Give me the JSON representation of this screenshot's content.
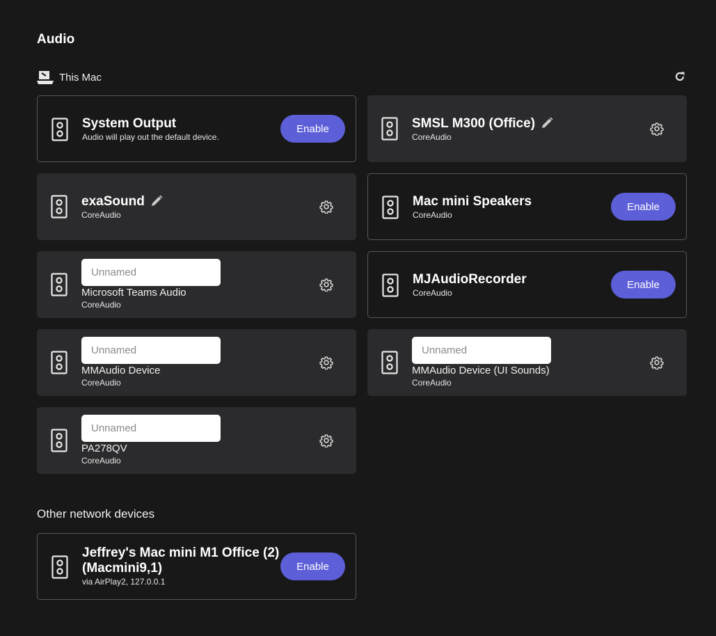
{
  "page": {
    "title": "Audio"
  },
  "this_mac": {
    "label": "This Mac"
  },
  "devices": {
    "system_output": {
      "name": "System Output",
      "subtitle": "Audio will play out the default device.",
      "button": "Enable"
    },
    "smsl": {
      "name": "SMSL M300 (Office)",
      "subtitle": "CoreAudio"
    },
    "exasound": {
      "name": "exaSound",
      "subtitle": "CoreAudio"
    },
    "mac_mini_speakers": {
      "name": "Mac mini Speakers",
      "subtitle": "CoreAudio",
      "button": "Enable"
    },
    "teams": {
      "placeholder": "Unnamed",
      "name": "Microsoft Teams Audio",
      "subtitle": "CoreAudio"
    },
    "mjaudio": {
      "name": "MJAudioRecorder",
      "subtitle": "CoreAudio",
      "button": "Enable"
    },
    "mmaudio": {
      "placeholder": "Unnamed",
      "name": "MMAudio Device",
      "subtitle": "CoreAudio"
    },
    "mmaudio_ui": {
      "placeholder": "Unnamed",
      "name": "MMAudio Device (UI Sounds)",
      "subtitle": "CoreAudio"
    },
    "pa278": {
      "placeholder": "Unnamed",
      "name": "PA278QV",
      "subtitle": "CoreAudio"
    }
  },
  "other_network": {
    "title": "Other network devices",
    "device": {
      "name": "Jeffrey's Mac mini M1 Office (2) (Macmini9,1)",
      "subtitle": "via AirPlay2, 127.0.0.1",
      "button": "Enable"
    }
  },
  "colors": {
    "background": "#181818",
    "card": "#2b2b2d",
    "accent": "#5d5fd8",
    "outline": "#565656"
  },
  "icons": [
    "laptop-icon",
    "refresh-icon",
    "speaker-icon",
    "pencil-icon",
    "gear-icon"
  ]
}
